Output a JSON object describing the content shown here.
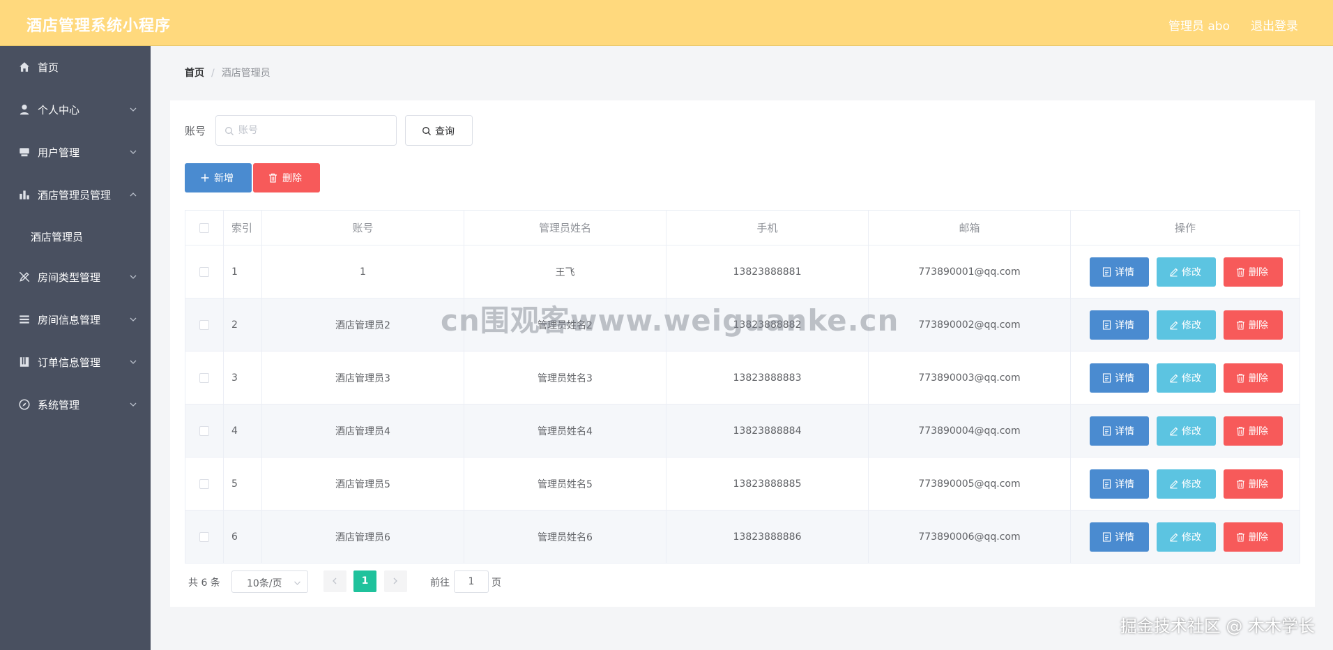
{
  "header": {
    "app_title": "酒店管理系统小程序",
    "user_label": "管理员 abo",
    "logout_label": "退出登录"
  },
  "sidebar": {
    "items": [
      {
        "label": "首页",
        "icon": "home-icon"
      },
      {
        "label": "个人中心",
        "icon": "user-icon"
      },
      {
        "label": "用户管理",
        "icon": "user-manage-icon"
      },
      {
        "label": "酒店管理员管理",
        "icon": "bar-chart-icon",
        "expanded": true
      },
      {
        "label": "房间类型管理",
        "icon": "edit-off-icon"
      },
      {
        "label": "房间信息管理",
        "icon": "list-icon"
      },
      {
        "label": "订单信息管理",
        "icon": "document-icon"
      },
      {
        "label": "系统管理",
        "icon": "compass-icon"
      }
    ],
    "subitem": "酒店管理员"
  },
  "breadcrumb": {
    "home": "首页",
    "separator": "/",
    "current": "酒店管理员"
  },
  "search": {
    "label": "账号",
    "placeholder": "账号",
    "value": "",
    "button": "查询"
  },
  "actions": {
    "add": "新增",
    "delete": "删除"
  },
  "table": {
    "headers": [
      "索引",
      "账号",
      "管理员姓名",
      "手机",
      "邮箱",
      "操作"
    ],
    "rows": [
      {
        "index": "1",
        "account": "1",
        "name": "王飞",
        "phone": "13823888881",
        "email": "773890001@qq.com"
      },
      {
        "index": "2",
        "account": "酒店管理员2",
        "name": "管理员姓名2",
        "phone": "13823888882",
        "email": "773890002@qq.com"
      },
      {
        "index": "3",
        "account": "酒店管理员3",
        "name": "管理员姓名3",
        "phone": "13823888883",
        "email": "773890003@qq.com"
      },
      {
        "index": "4",
        "account": "酒店管理员4",
        "name": "管理员姓名4",
        "phone": "13823888884",
        "email": "773890004@qq.com"
      },
      {
        "index": "5",
        "account": "酒店管理员5",
        "name": "管理员姓名5",
        "phone": "13823888885",
        "email": "773890005@qq.com"
      },
      {
        "index": "6",
        "account": "酒店管理员6",
        "name": "管理员姓名6",
        "phone": "13823888886",
        "email": "773890006@qq.com"
      }
    ],
    "row_actions": {
      "detail": "详情",
      "edit": "修改",
      "delete": "删除"
    }
  },
  "pagination": {
    "total": "共 6 条",
    "page_size": "10条/页",
    "current_page": "1",
    "goto_label": "前往",
    "goto_value": "1",
    "page_unit": "页"
  },
  "overlay": {
    "watermark": "cn围观客www.weiguanke.cn",
    "credit": "掘金技术社区 @ 木木学长"
  },
  "colors": {
    "header_bg": "#ffd97d",
    "sidebar_bg": "#495060",
    "primary": "#4a8bd0",
    "info": "#5cc4e1",
    "danger": "#f75a5a",
    "pagination_active": "#1fc29c"
  }
}
